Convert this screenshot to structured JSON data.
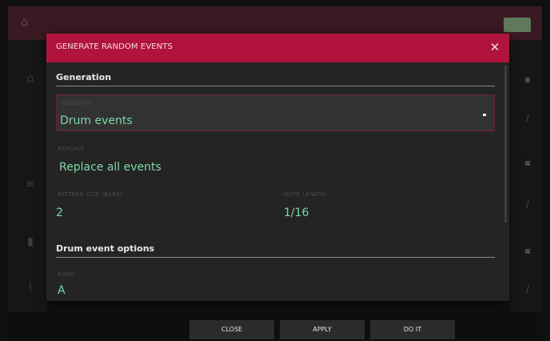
{
  "dialog": {
    "title": "GENERATE RANDOM EVENTS",
    "close_icon": "close-icon"
  },
  "generation": {
    "section_title": "Generation",
    "generate_label": "GENERATE",
    "generate_value": "Drum events",
    "replace_label": "REPLACE",
    "replace_value": "Replace all events",
    "pattern_size_label": "PATTERN SIZE (BARS)",
    "pattern_size_value": "2",
    "note_length_label": "NOTE LENGTH",
    "note_length_value": "1/16"
  },
  "drum_options": {
    "section_title": "Drum event options",
    "bank_label": "BANK",
    "bank_value": "A"
  },
  "bottom_buttons": {
    "close": "CLOSE",
    "apply": "APPLY",
    "do_it": "DO IT"
  },
  "colors": {
    "header": "#b0143c",
    "value_text": "#7fd6a8",
    "dialog_bg": "#242424"
  }
}
